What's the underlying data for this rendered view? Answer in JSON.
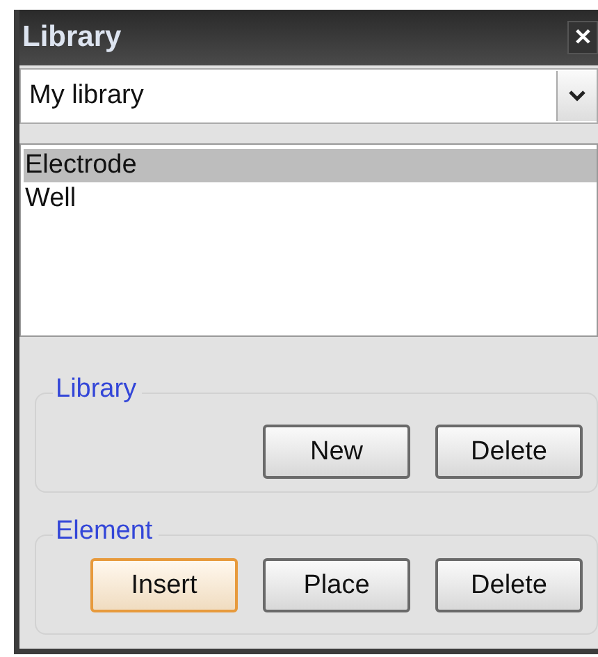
{
  "window": {
    "title": "Library",
    "close": "✕"
  },
  "library_select": {
    "value": "My library"
  },
  "elements": [
    {
      "label": "Electrode",
      "selected": true
    },
    {
      "label": "Well",
      "selected": false
    }
  ],
  "groups": [
    {
      "title": "Library",
      "buttons": [
        {
          "label": "New",
          "focused": false
        },
        {
          "label": "Delete",
          "focused": false
        }
      ]
    },
    {
      "title": "Element",
      "buttons": [
        {
          "label": "Insert",
          "focused": true
        },
        {
          "label": "Place",
          "focused": false
        },
        {
          "label": "Delete",
          "focused": false
        }
      ]
    }
  ]
}
